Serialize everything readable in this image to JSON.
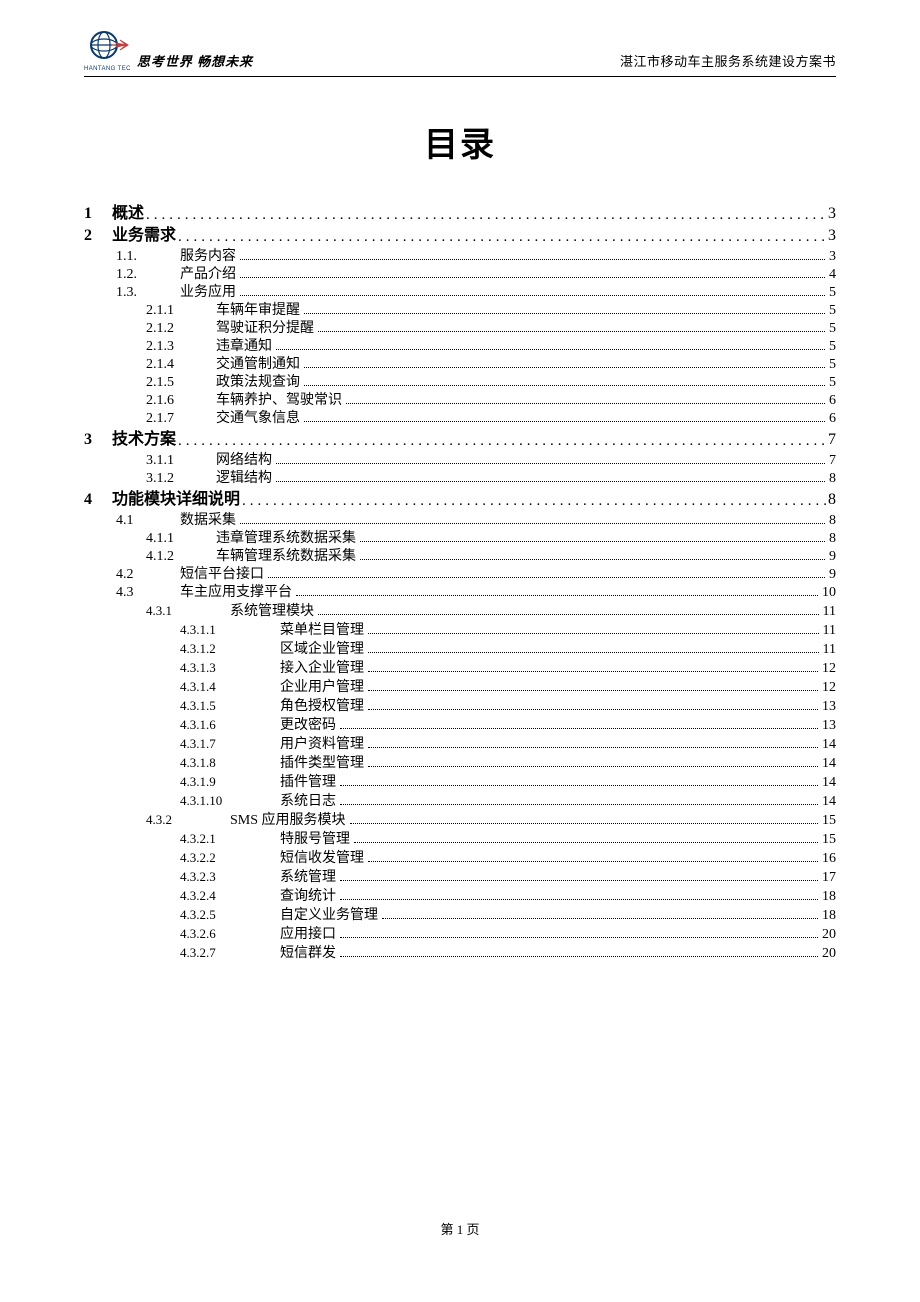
{
  "header": {
    "company_sub": "HANTANG TEC",
    "slogan": "思考世界 畅想未来",
    "doc_title": "湛江市移动车主服务系统建设方案书"
  },
  "title": "目录",
  "toc": [
    {
      "level": 0,
      "section_no": "1",
      "num": "",
      "label": "概述",
      "page": "3"
    },
    {
      "level": 0,
      "section_no": "2",
      "num": "",
      "label": "业务需求",
      "page": "3"
    },
    {
      "level": 1,
      "num": "1.1.",
      "label": "服务内容",
      "page": "3"
    },
    {
      "level": 1,
      "num": "1.2.",
      "label": "产品介绍",
      "page": "4"
    },
    {
      "level": 1,
      "num": "1.3.",
      "label": "业务应用",
      "page": "5"
    },
    {
      "level": 2,
      "num": "2.1.1",
      "label": "车辆年审提醒",
      "page": "5"
    },
    {
      "level": 2,
      "num": "2.1.2",
      "label": "驾驶证积分提醒",
      "page": "5"
    },
    {
      "level": 2,
      "num": "2.1.3",
      "label": "违章通知",
      "page": "5"
    },
    {
      "level": 2,
      "num": "2.1.4",
      "label": "交通管制通知",
      "page": "5"
    },
    {
      "level": 2,
      "num": "2.1.5",
      "label": "政策法规查询",
      "page": "5"
    },
    {
      "level": 2,
      "num": "2.1.6",
      "label": "车辆养护、驾驶常识",
      "page": "6"
    },
    {
      "level": 2,
      "num": "2.1.7",
      "label": "交通气象信息",
      "page": "6"
    },
    {
      "level": 0,
      "section_no": "3",
      "num": "",
      "label": "技术方案",
      "page": "7"
    },
    {
      "level": 2,
      "num": "3.1.1",
      "label": "网络结构",
      "page": "7"
    },
    {
      "level": 2,
      "num": "3.1.2",
      "label": "逻辑结构",
      "page": "8"
    },
    {
      "level": 0,
      "section_no": "4",
      "num": "",
      "label": "功能模块详细说明",
      "page": "8"
    },
    {
      "level": 1,
      "num": "4.1",
      "label": "数据采集",
      "page": "8"
    },
    {
      "level": 2,
      "num": "4.1.1",
      "label": "违章管理系统数据采集",
      "page": "8"
    },
    {
      "level": 2,
      "num": "4.1.2",
      "label": "车辆管理系统数据采集",
      "page": "9"
    },
    {
      "level": 1,
      "num": "4.2",
      "label": "短信平台接口",
      "page": "9"
    },
    {
      "level": 1,
      "num": "4.3",
      "label": "车主应用支撑平台",
      "page": "10"
    },
    {
      "level": 3,
      "num": "4.3.1",
      "label": "系统管理模块",
      "page": "11"
    },
    {
      "level": 4,
      "num": "4.3.1.1",
      "label": "菜单栏目管理",
      "page": "11"
    },
    {
      "level": 4,
      "num": "4.3.1.2",
      "label": "区域企业管理",
      "page": "11"
    },
    {
      "level": 4,
      "num": "4.3.1.3",
      "label": "接入企业管理",
      "page": "12"
    },
    {
      "level": 4,
      "num": "4.3.1.4",
      "label": "企业用户管理",
      "page": "12"
    },
    {
      "level": 4,
      "num": "4.3.1.5",
      "label": "角色授权管理",
      "page": "13"
    },
    {
      "level": 4,
      "num": "4.3.1.6",
      "label": "更改密码",
      "page": "13"
    },
    {
      "level": 4,
      "num": "4.3.1.7",
      "label": "用户资料管理",
      "page": "14"
    },
    {
      "level": 4,
      "num": "4.3.1.8",
      "label": "插件类型管理",
      "page": "14"
    },
    {
      "level": 4,
      "num": "4.3.1.9",
      "label": "插件管理",
      "page": "14"
    },
    {
      "level": 4,
      "num": "4.3.1.10",
      "label": "系统日志",
      "page": "14"
    },
    {
      "level": 3,
      "num": "4.3.2",
      "label": "SMS 应用服务模块",
      "page": "15"
    },
    {
      "level": 4,
      "num": "4.3.2.1",
      "label": "特服号管理",
      "page": "15"
    },
    {
      "level": 4,
      "num": "4.3.2.2",
      "label": "短信收发管理",
      "page": "16"
    },
    {
      "level": 4,
      "num": "4.3.2.3",
      "label": "系统管理",
      "page": "17"
    },
    {
      "level": 4,
      "num": "4.3.2.4",
      "label": "查询统计",
      "page": "18"
    },
    {
      "level": 4,
      "num": "4.3.2.5",
      "label": "自定义业务管理",
      "page": "18"
    },
    {
      "level": 4,
      "num": "4.3.2.6",
      "label": "应用接口",
      "page": "20"
    },
    {
      "level": 4,
      "num": "4.3.2.7",
      "label": "短信群发",
      "page": "20"
    }
  ],
  "footer": "第 1 页"
}
